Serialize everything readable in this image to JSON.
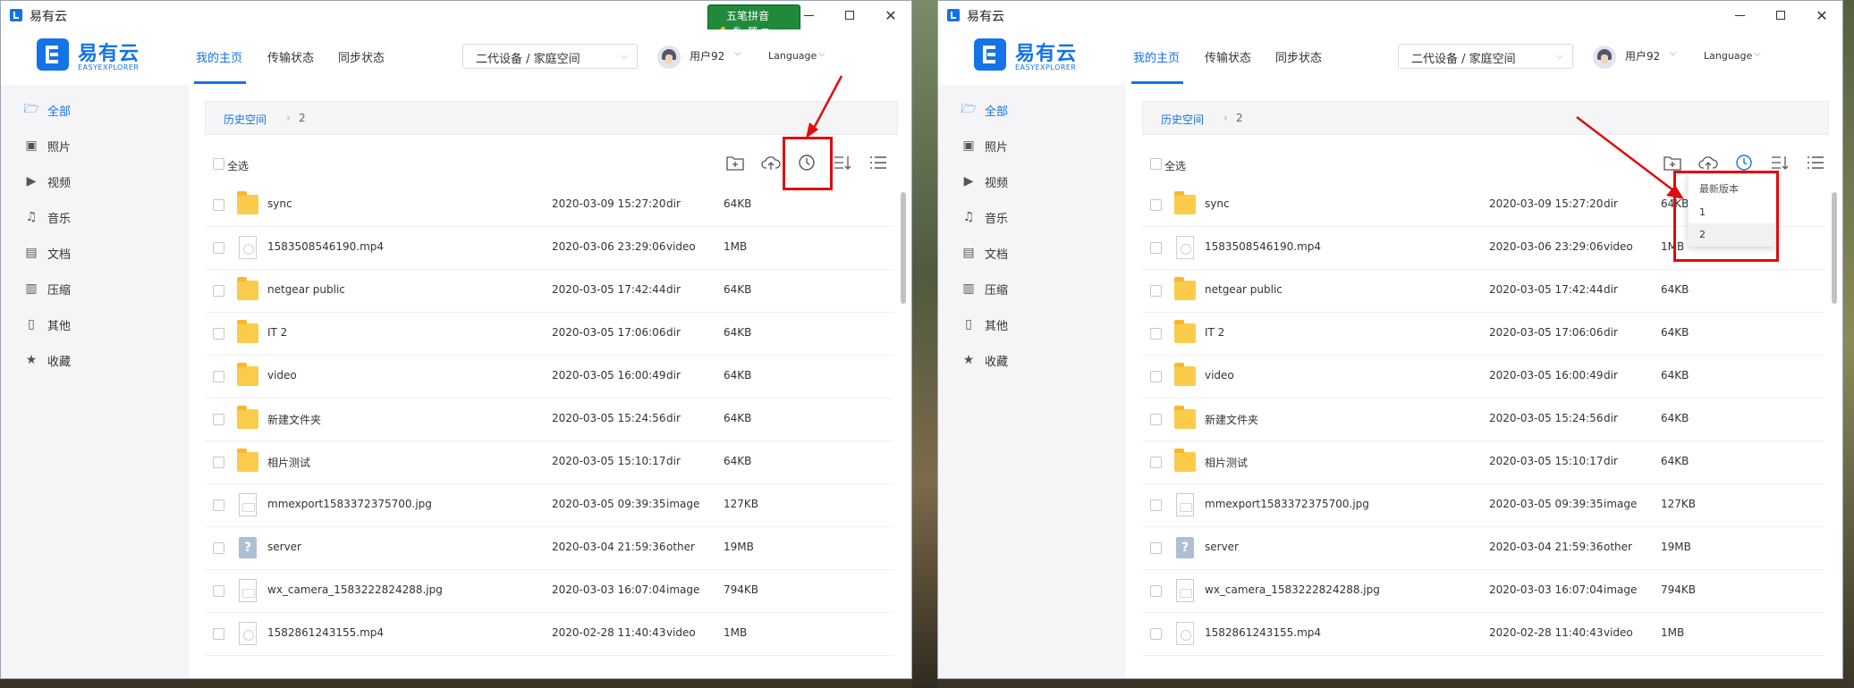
{
  "app": {
    "title": "易有云",
    "logo_cn": "易有云",
    "logo_en": "EASYEXPLORER"
  },
  "ime": {
    "line1": "五笔拼音",
    "line2": "✋ 🔍 繁 ⊞"
  },
  "nav": {
    "tabs": [
      {
        "label": "我的主页",
        "active": true
      },
      {
        "label": "传输状态",
        "active": false
      },
      {
        "label": "同步状态",
        "active": false
      }
    ],
    "device": "二代设备 / 家庭空间",
    "user": "用户92",
    "language": "Language"
  },
  "sidebar": {
    "items": [
      {
        "label": "全部",
        "icon": "folder-open-icon",
        "active": true
      },
      {
        "label": "照片",
        "icon": "image-icon",
        "active": false
      },
      {
        "label": "视频",
        "icon": "video-icon",
        "active": false
      },
      {
        "label": "音乐",
        "icon": "music-icon",
        "active": false
      },
      {
        "label": "文档",
        "icon": "document-icon",
        "active": false
      },
      {
        "label": "压缩",
        "icon": "archive-icon",
        "active": false
      },
      {
        "label": "其他",
        "icon": "file-icon",
        "active": false
      },
      {
        "label": "收藏",
        "icon": "star-icon",
        "active": false
      }
    ]
  },
  "breadcrumb": {
    "root": "历史空间",
    "separator": "›",
    "current": "2"
  },
  "toolbar": {
    "select_all": "全选",
    "icons": [
      "new-folder-icon",
      "upload-icon",
      "history-icon",
      "sort-icon",
      "list-view-icon"
    ]
  },
  "files": [
    {
      "name": "sync",
      "date": "2020-03-09 15:27:20",
      "type": "dir",
      "size": "64KB",
      "kind": "folder"
    },
    {
      "name": "1583508546190.mp4",
      "date": "2020-03-06 23:29:06",
      "type": "video",
      "size": "1MB",
      "kind": "image"
    },
    {
      "name": "netgear public",
      "date": "2020-03-05 17:42:44",
      "type": "dir",
      "size": "64KB",
      "kind": "folder"
    },
    {
      "name": "IT 2",
      "date": "2020-03-05 17:06:06",
      "type": "dir",
      "size": "64KB",
      "kind": "folder"
    },
    {
      "name": "video",
      "date": "2020-03-05 16:00:49",
      "type": "dir",
      "size": "64KB",
      "kind": "folder"
    },
    {
      "name": "新建文件夹",
      "date": "2020-03-05 15:24:56",
      "type": "dir",
      "size": "64KB",
      "kind": "folder"
    },
    {
      "name": "相片测试",
      "date": "2020-03-05 15:10:17",
      "type": "dir",
      "size": "64KB",
      "kind": "folder"
    },
    {
      "name": "mmexport1583372375700.jpg",
      "date": "2020-03-05 09:39:35",
      "type": "image",
      "size": "127KB",
      "kind": "doc"
    },
    {
      "name": "server",
      "date": "2020-03-04 21:59:36",
      "type": "other",
      "size": "19MB",
      "kind": "unknown"
    },
    {
      "name": "wx_camera_1583222824288.jpg",
      "date": "2020-03-03 16:07:04",
      "type": "image",
      "size": "794KB",
      "kind": "doc"
    },
    {
      "name": "1582861243155.mp4",
      "date": "2020-02-28 11:40:43",
      "type": "video",
      "size": "1MB",
      "kind": "image"
    }
  ],
  "version_menu": {
    "title": "最新版本",
    "items": [
      "1",
      "2"
    ]
  },
  "colors": {
    "accent": "#1473e6",
    "annotation": "#e10b0b",
    "folder": "#fbcb4c"
  }
}
